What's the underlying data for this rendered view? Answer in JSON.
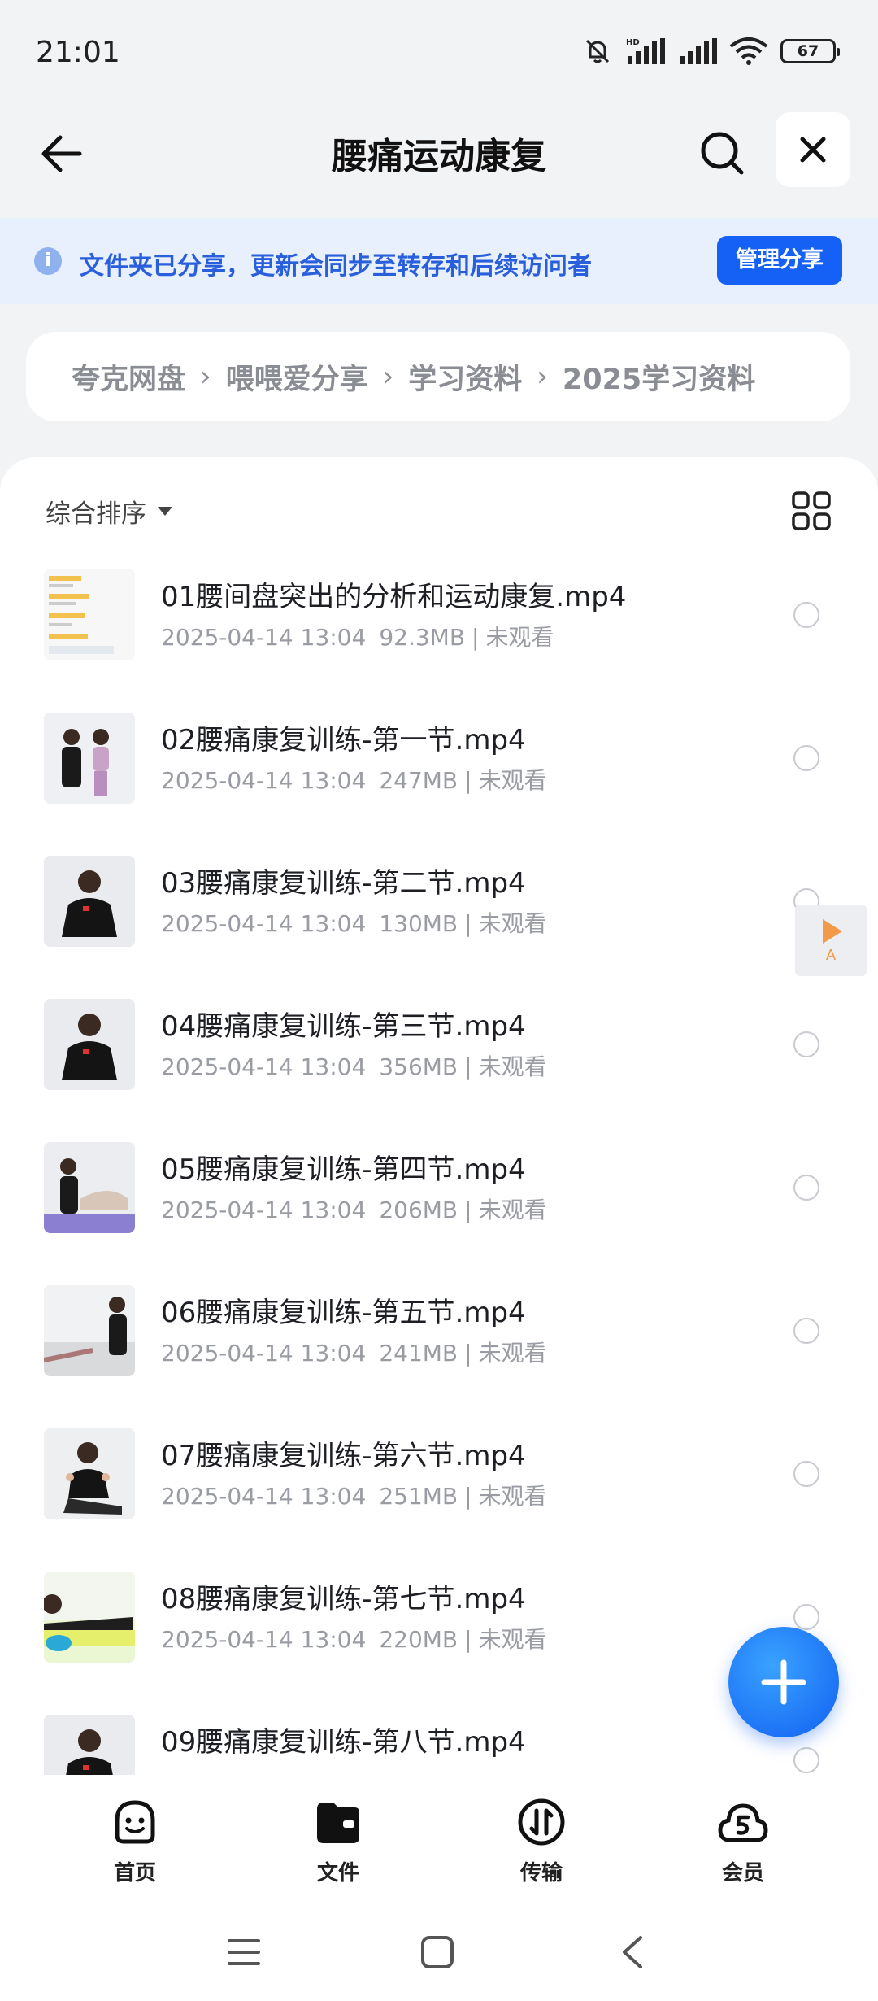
{
  "status_bar": {
    "time": "21:01",
    "battery": "67",
    "icons": [
      "mute-bell-icon",
      "hd-signal-icon",
      "signal-icon",
      "wifi-icon",
      "battery-icon"
    ]
  },
  "nav": {
    "title": "腰痛运动康复",
    "icons": [
      "back-arrow-icon",
      "search-icon",
      "close-icon"
    ]
  },
  "share_banner": {
    "text": "文件夹已分享，更新会同步至转存和后续访问者",
    "button": "管理分享",
    "colors": {
      "background": "#e8effd",
      "text": "#2a5fdc",
      "button": "#1560f5"
    }
  },
  "breadcrumb": [
    "夸克网盘",
    "喂喂爱分享",
    "学习资料",
    "2025学习资料"
  ],
  "toolbar": {
    "sort_label": "综合排序"
  },
  "files": [
    {
      "name": "01腰间盘突出的分析和运动康复.mp4",
      "date": "2025-04-14 13:04",
      "size": "92.3MB",
      "status": "未观看",
      "thumb": "chat"
    },
    {
      "name": "02腰痛康复训练-第一节.mp4",
      "date": "2025-04-14 13:04",
      "size": "247MB",
      "status": "未观看",
      "thumb": "two"
    },
    {
      "name": "03腰痛康复训练-第二节.mp4",
      "date": "2025-04-14 13:04",
      "size": "130MB",
      "status": "未观看",
      "thumb": "sit"
    },
    {
      "name": "04腰痛康复训练-第三节.mp4",
      "date": "2025-04-14 13:04",
      "size": "356MB",
      "status": "未观看",
      "thumb": "sit"
    },
    {
      "name": "05腰痛康复训练-第四节.mp4",
      "date": "2025-04-14 13:04",
      "size": "206MB",
      "status": "未观看",
      "thumb": "mat"
    },
    {
      "name": "06腰痛康复训练-第五节.mp4",
      "date": "2025-04-14 13:04",
      "size": "241MB",
      "status": "未观看",
      "thumb": "room"
    },
    {
      "name": "07腰痛康复训练-第六节.mp4",
      "date": "2025-04-14 13:04",
      "size": "251MB",
      "status": "未观看",
      "thumb": "kneel"
    },
    {
      "name": "08腰痛康复训练-第七节.mp4",
      "date": "2025-04-14 13:04",
      "size": "220MB",
      "status": "未观看",
      "thumb": "roller"
    },
    {
      "name": "09腰痛康复训练-第八节.mp4",
      "date": "",
      "size": "",
      "status": "",
      "thumb": "sit"
    }
  ],
  "float_player": {
    "label": "A"
  },
  "tabs": [
    {
      "label": "首页",
      "icon": "smile-home-icon"
    },
    {
      "label": "文件",
      "icon": "folder-icon"
    },
    {
      "label": "传输",
      "icon": "transfer-icon"
    },
    {
      "label": "会员",
      "icon": "vip-cloud-icon"
    }
  ],
  "system_nav": [
    "menu-icon",
    "home-square-icon",
    "back-chevron-icon"
  ]
}
